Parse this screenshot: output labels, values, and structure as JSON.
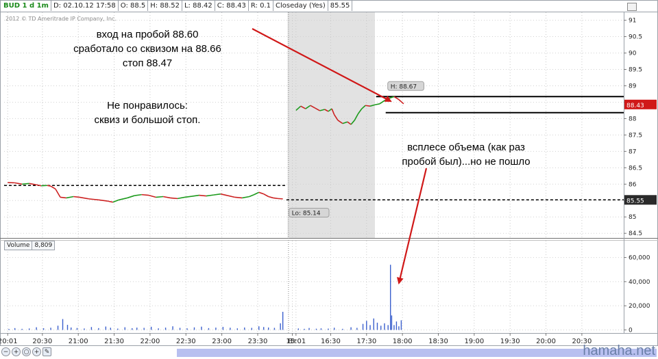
{
  "header": {
    "symbol": "BUD 1 d 1m",
    "date": "D: 02.10.12 17:58",
    "open": "O: 88.5",
    "high": "H: 88.52",
    "low": "L: 88.42",
    "close": "C: 88.43",
    "range": "R: 0.1",
    "study": "Closeday (Yes)",
    "closeday_value": "85.55"
  },
  "copyright": "2012 © TD Ameritrade IP Company, Inc.",
  "annotations": {
    "entry_line1": "вход на пробой 88.60",
    "entry_line2": "сработало со сквизом на 88.66",
    "entry_line3": "стоп 88.47",
    "dislike_line1": "Не понравилось:",
    "dislike_line2": "сквиз и большой стоп.",
    "volume_line1": "всплесе объема (как раз",
    "volume_line2": "пробой был)...но не пошло"
  },
  "volume_panel": {
    "label": "Volume",
    "value": "8,809"
  },
  "watermark": "hamaha.net",
  "colors": {
    "up": "#1c9a1c",
    "down": "#cc2020",
    "arrow": "#d01818",
    "volume": "#3a5fcd",
    "price_tag": "#d01818"
  },
  "chart_data": {
    "type": "candlestick",
    "price_axis": {
      "ticks": [
        "84.5",
        "85",
        "85.5",
        "86",
        "86.5",
        "87",
        "87.5",
        "88",
        "88.5",
        "89",
        "89.5",
        "90",
        "90.5",
        "91"
      ],
      "ylim": [
        84.4,
        91.2
      ]
    },
    "volume_axis": {
      "ticks": [
        "0",
        "20,000",
        "40,000",
        "60,000"
      ],
      "ylim": [
        -2000,
        66000
      ]
    },
    "time_axis": {
      "labels": [
        "20:01",
        "20:30",
        "21:00",
        "21:30",
        "22:00",
        "22:30",
        "23:00",
        "23:30",
        "Вт",
        "15:01",
        "16:30",
        "17:30",
        "18:00",
        "18:30",
        "19:00",
        "19:30",
        "20:00",
        "20:30"
      ],
      "values": [
        0,
        29,
        59,
        89,
        119,
        149,
        179,
        209,
        238,
        241,
        270,
        300,
        330,
        360,
        390,
        420,
        450,
        480
      ],
      "xlim": [
        -3,
        515
      ]
    },
    "price_series": [
      [
        0,
        86.05
      ],
      [
        6,
        86.04
      ],
      [
        12,
        86.0
      ],
      [
        18,
        86.02
      ],
      [
        24,
        85.98
      ],
      [
        28,
        85.95
      ],
      [
        33,
        85.96
      ],
      [
        36,
        85.94
      ],
      [
        40,
        85.85
      ],
      [
        44,
        85.6
      ],
      [
        49,
        85.58
      ],
      [
        55,
        85.62
      ],
      [
        60,
        85.6
      ],
      [
        68,
        85.55
      ],
      [
        76,
        85.52
      ],
      [
        84,
        85.48
      ],
      [
        88,
        85.45
      ],
      [
        93,
        85.52
      ],
      [
        100,
        85.58
      ],
      [
        106,
        85.65
      ],
      [
        112,
        85.68
      ],
      [
        118,
        85.66
      ],
      [
        124,
        85.6
      ],
      [
        130,
        85.62
      ],
      [
        136,
        85.58
      ],
      [
        142,
        85.56
      ],
      [
        148,
        85.6
      ],
      [
        154,
        85.63
      ],
      [
        160,
        85.66
      ],
      [
        166,
        85.64
      ],
      [
        172,
        85.67
      ],
      [
        178,
        85.7
      ],
      [
        184,
        85.65
      ],
      [
        190,
        85.6
      ],
      [
        196,
        85.58
      ],
      [
        202,
        85.62
      ],
      [
        206,
        85.68
      ],
      [
        210,
        85.75
      ],
      [
        214,
        85.7
      ],
      [
        218,
        85.62
      ],
      [
        222,
        85.58
      ],
      [
        226,
        85.56
      ],
      [
        230,
        85.55
      ],
      [
        241,
        88.25
      ],
      [
        245,
        88.38
      ],
      [
        249,
        88.3
      ],
      [
        253,
        88.4
      ],
      [
        257,
        88.32
      ],
      [
        261,
        88.24
      ],
      [
        265,
        88.28
      ],
      [
        268,
        88.22
      ],
      [
        271,
        88.3
      ],
      [
        273,
        88.12
      ],
      [
        276,
        87.95
      ],
      [
        280,
        87.85
      ],
      [
        284,
        87.9
      ],
      [
        287,
        87.82
      ],
      [
        290,
        87.95
      ],
      [
        293,
        88.15
      ],
      [
        296,
        88.3
      ],
      [
        299,
        88.4
      ],
      [
        303,
        88.38
      ],
      [
        307,
        88.42
      ],
      [
        311,
        88.45
      ],
      [
        315,
        88.55
      ],
      [
        319,
        88.62
      ],
      [
        323,
        88.67
      ],
      [
        327,
        88.58
      ],
      [
        331,
        88.45
      ]
    ],
    "volume_series": [
      [
        1,
        800
      ],
      [
        6,
        1500
      ],
      [
        12,
        900
      ],
      [
        18,
        1200
      ],
      [
        24,
        2200
      ],
      [
        30,
        1400
      ],
      [
        36,
        1800
      ],
      [
        42,
        3500
      ],
      [
        46,
        9000
      ],
      [
        50,
        4200
      ],
      [
        53,
        2000
      ],
      [
        58,
        1600
      ],
      [
        64,
        1200
      ],
      [
        70,
        2400
      ],
      [
        76,
        1500
      ],
      [
        82,
        2800
      ],
      [
        86,
        1800
      ],
      [
        92,
        1100
      ],
      [
        98,
        2200
      ],
      [
        104,
        1400
      ],
      [
        108,
        1900
      ],
      [
        114,
        1700
      ],
      [
        120,
        2600
      ],
      [
        126,
        1300
      ],
      [
        132,
        1900
      ],
      [
        138,
        3000
      ],
      [
        144,
        1700
      ],
      [
        150,
        1300
      ],
      [
        156,
        2100
      ],
      [
        162,
        2700
      ],
      [
        168,
        1500
      ],
      [
        174,
        1900
      ],
      [
        180,
        2500
      ],
      [
        186,
        1800
      ],
      [
        192,
        1300
      ],
      [
        198,
        2000
      ],
      [
        204,
        1700
      ],
      [
        210,
        3000
      ],
      [
        214,
        2400
      ],
      [
        218,
        2000
      ],
      [
        223,
        1700
      ],
      [
        228,
        5500
      ],
      [
        230,
        15000
      ],
      [
        243,
        1200
      ],
      [
        248,
        900
      ],
      [
        252,
        1600
      ],
      [
        258,
        1000
      ],
      [
        262,
        1300
      ],
      [
        268,
        1100
      ],
      [
        273,
        1800
      ],
      [
        280,
        900
      ],
      [
        287,
        2200
      ],
      [
        292,
        1700
      ],
      [
        297,
        5000
      ],
      [
        300,
        7500
      ],
      [
        303,
        4000
      ],
      [
        306,
        9500
      ],
      [
        309,
        6000
      ],
      [
        312,
        3500
      ],
      [
        315,
        5500
      ],
      [
        318,
        4000
      ],
      [
        320,
        54000
      ],
      [
        321,
        12000
      ],
      [
        323,
        4000
      ],
      [
        325,
        7000
      ],
      [
        327,
        3000
      ],
      [
        329,
        8000
      ]
    ],
    "price_labels": {
      "high": "H: 88.67",
      "low": "Lo: 85.14",
      "last": "88.43",
      "closeday": "85.55"
    },
    "levels": [
      {
        "name": "entry",
        "value": 88.67,
        "from": 308,
        "to": 515
      },
      {
        "name": "stop",
        "value": 88.18,
        "from": 316,
        "to": 515
      },
      {
        "name": "prev-close-session1",
        "value": 85.96,
        "from": -3,
        "to": 233
      },
      {
        "name": "prev-close-session2",
        "value": 85.52,
        "from": 233,
        "to": 515
      }
    ],
    "shaded_region": [
      234,
      307
    ],
    "grid": true
  }
}
